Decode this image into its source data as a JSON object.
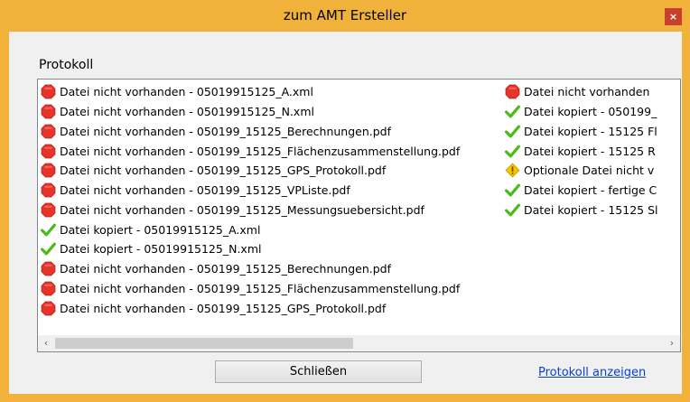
{
  "window": {
    "title": "zum AMT Ersteller",
    "close_glyph": "×"
  },
  "protokoll_label": "Protokoll",
  "log_left": [
    {
      "icon": "error",
      "text": "Datei nicht vorhanden - 05019915125_A.xml"
    },
    {
      "icon": "error",
      "text": "Datei nicht vorhanden - 05019915125_N.xml"
    },
    {
      "icon": "error",
      "text": "Datei nicht vorhanden - 050199_15125_Berechnungen.pdf"
    },
    {
      "icon": "error",
      "text": "Datei nicht vorhanden - 050199_15125_Flächenzusammenstellung.pdf"
    },
    {
      "icon": "error",
      "text": "Datei nicht vorhanden - 050199_15125_GPS_Protokoll.pdf"
    },
    {
      "icon": "error",
      "text": "Datei nicht vorhanden - 050199_15125_VPListe.pdf"
    },
    {
      "icon": "error",
      "text": "Datei nicht vorhanden - 050199_15125_Messungsuebersicht.pdf"
    },
    {
      "icon": "ok",
      "text": "Datei kopiert - 05019915125_A.xml"
    },
    {
      "icon": "ok",
      "text": "Datei kopiert - 05019915125_N.xml"
    },
    {
      "icon": "error",
      "text": "Datei nicht vorhanden - 050199_15125_Berechnungen.pdf"
    },
    {
      "icon": "error",
      "text": "Datei nicht vorhanden - 050199_15125_Flächenzusammenstellung.pdf"
    },
    {
      "icon": "error",
      "text": "Datei nicht vorhanden - 050199_15125_GPS_Protokoll.pdf"
    }
  ],
  "log_right": [
    {
      "icon": "error",
      "text": "Datei nicht vorhanden"
    },
    {
      "icon": "ok",
      "text": "Datei kopiert - 050199_"
    },
    {
      "icon": "ok",
      "text": "Datei kopiert - 15125 Fl"
    },
    {
      "icon": "ok",
      "text": "Datei kopiert - 15125 R"
    },
    {
      "icon": "warning",
      "text": "Optionale Datei nicht v"
    },
    {
      "icon": "ok",
      "text": "Datei kopiert - fertige C"
    },
    {
      "icon": "ok",
      "text": "Datei kopiert - 15125 Sl"
    }
  ],
  "scroll": {
    "left_glyph": "‹",
    "right_glyph": "›"
  },
  "close_button_label": "Schließen",
  "show_log_link": "Protokoll anzeigen",
  "colors": {
    "accent": "#f0b23a",
    "error": "#e8332a",
    "ok": "#4cbb17",
    "warning": "#f5c400",
    "link": "#0a43c7"
  }
}
